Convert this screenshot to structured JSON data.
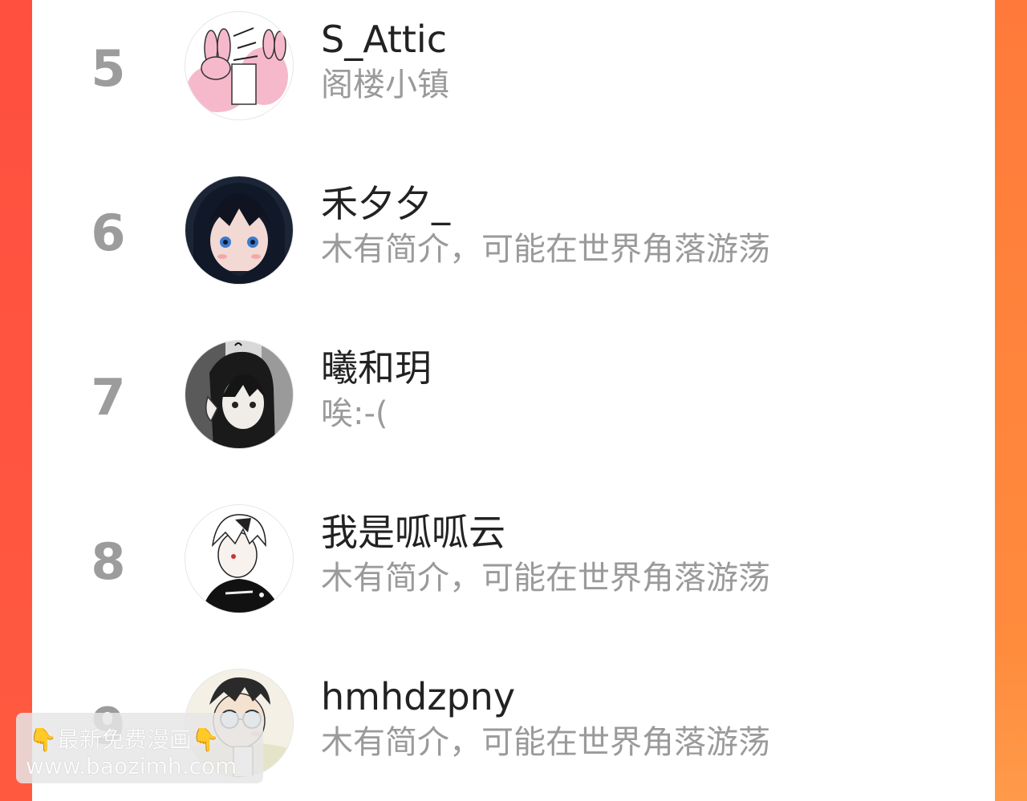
{
  "colors": {
    "accent_left": "#ff4f3f",
    "accent_right": "#ff8b3d",
    "rank_gray": "#9c9c9c",
    "name_dark": "#222222",
    "bio_gray": "#9a9a9a"
  },
  "ranking": [
    {
      "rank": "5",
      "name": "S_Attic",
      "bio": "阁楼小镇",
      "avatar_icon": "bunny-avatar"
    },
    {
      "rank": "6",
      "name": "禾夕夕_",
      "bio": "木有简介，可能在世界角落游荡",
      "avatar_icon": "anime-girl-avatar"
    },
    {
      "rank": "7",
      "name": "曦和玥",
      "bio": "唉:-(",
      "avatar_icon": "anime-girl-bw-avatar"
    },
    {
      "rank": "8",
      "name": "我是呱呱云",
      "bio": "木有简介，可能在世界角落游荡",
      "avatar_icon": "white-hair-avatar"
    },
    {
      "rank": "9",
      "name": "hmhdzpny",
      "bio": "木有简介，可能在世界角落游荡",
      "avatar_icon": "glasses-boy-avatar"
    }
  ],
  "watermark": {
    "line1_left_icon": "👇",
    "line1_text": "最新免费漫画",
    "line1_right_icon": "👇",
    "line2_text": "www.baozimh.com"
  }
}
